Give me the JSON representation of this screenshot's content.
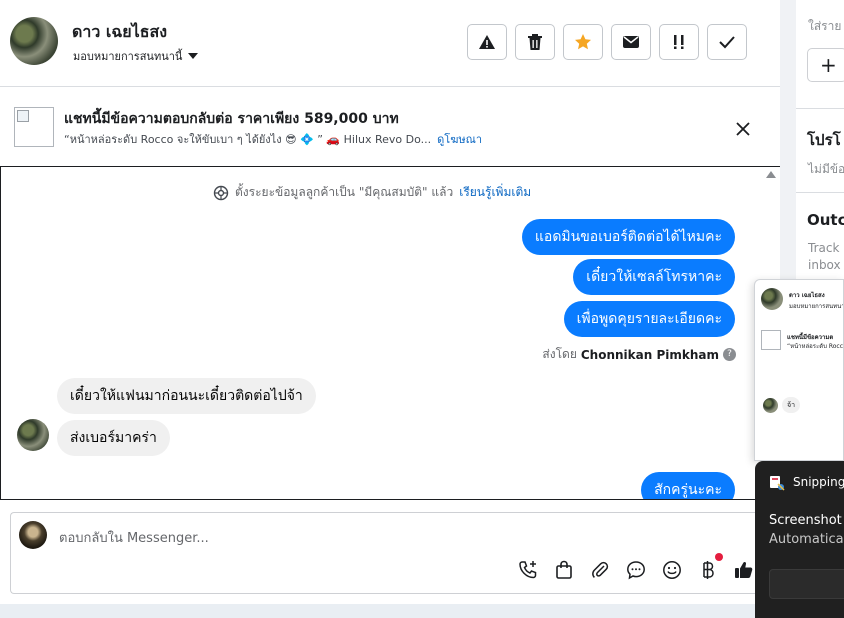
{
  "header": {
    "contact_name": "ดาว เฉยไธสง",
    "assign_label": "มอบหมายการสนทนานี้"
  },
  "ad": {
    "title": "แชทนี้มีข้อความตอบกลับต่อ ราคาเพียง 589,000 บาท",
    "snippet": "“หน้าหล่อระดับ Rocco จะให้ขับเบา ๆ ได้ยังไง 😎 💠 ” 🚗 Hilux Revo Do...",
    "link_label": "ดูโฆษณา"
  },
  "conversation": {
    "system_note": "ตั้งระยะข้อมูลลูกค้าเป็น \"มีคุณสมบัติ\" แล้ว",
    "learn_more": "เรียนรู้เพิ่มเติม",
    "outgoing_1": "แอดมินขอเบอร์ติดต่อได้ไหมคะ",
    "outgoing_2": "เดี๋ยวให้เซลล์โทรหาคะ",
    "outgoing_3": "เพื่อพูดคุยรายละเอียดคะ",
    "sent_by_prefix": "ส่งโดย",
    "sent_by_name": "Chonnikan Pimkham",
    "incoming_1": "เดี๋ยวให้แฟนมาก่อนนะเดี๋ยวติดต่อไปจ้า",
    "incoming_2": "ส่งเบอร์มาคร่า",
    "outgoing_4": "สักครู่นะคะ"
  },
  "composer": {
    "placeholder": "ตอบกลับใน Messenger..."
  },
  "right_panel": {
    "input_hint": "ใส่ราย",
    "add_symbol": "+",
    "promo_title": "โปรโ",
    "promo_note": "ไม่มีข้อ",
    "outcome_title": "Outc",
    "outcome_desc_1": "Track k",
    "outcome_desc_2": "inbox b"
  },
  "popup_preview": {
    "name": "ดาว เฉยไธสง",
    "sub": "มอบหมายการสนทนานี้",
    "ad_title": "แชทนี้มีข้อความต",
    "ad_snippet": "“หน้าหล่อระดับ Rocco จ",
    "bubble": "จ้า"
  },
  "snipping": {
    "title": "Snipping",
    "line1": "Screenshot c",
    "line2": "Automaticall"
  },
  "colors": {
    "messenger_blue": "#0a7cff",
    "link_blue": "#0a66c2",
    "star_orange": "#f5a623",
    "notification_red": "#e41e3f"
  }
}
